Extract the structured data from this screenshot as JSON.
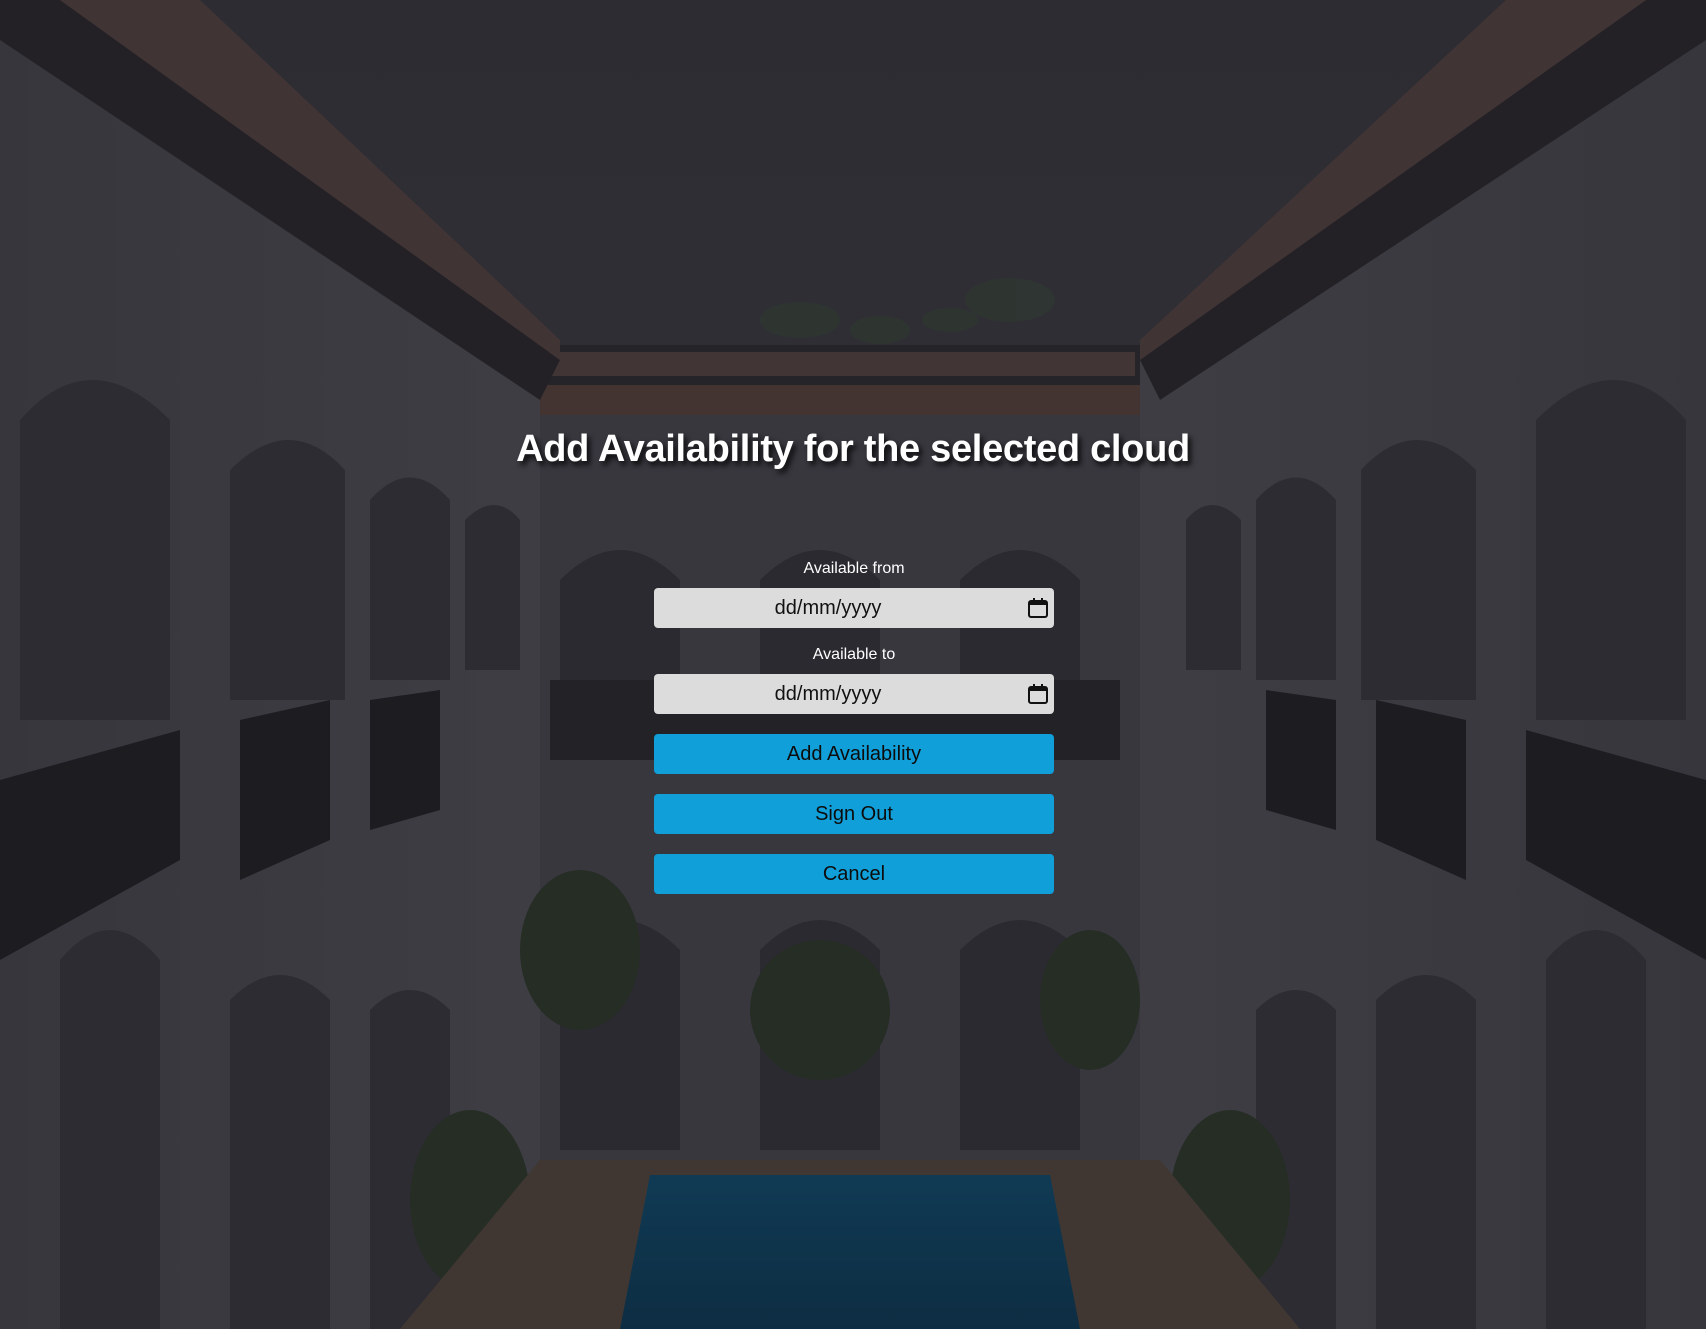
{
  "page": {
    "title": "Add Availability for the selected cloud"
  },
  "form": {
    "from_label": "Available from",
    "from_value": "dd/mm/yyyy",
    "to_label": "Available to",
    "to_value": "dd/mm/yyyy",
    "calendar_icon": "calendar-icon"
  },
  "actions": {
    "add_label": "Add Availability",
    "signout_label": "Sign Out",
    "cancel_label": "Cancel"
  },
  "colors": {
    "button_bg": "#119fd9",
    "field_bg": "#dcdcdc",
    "title_text": "#ffffff"
  }
}
